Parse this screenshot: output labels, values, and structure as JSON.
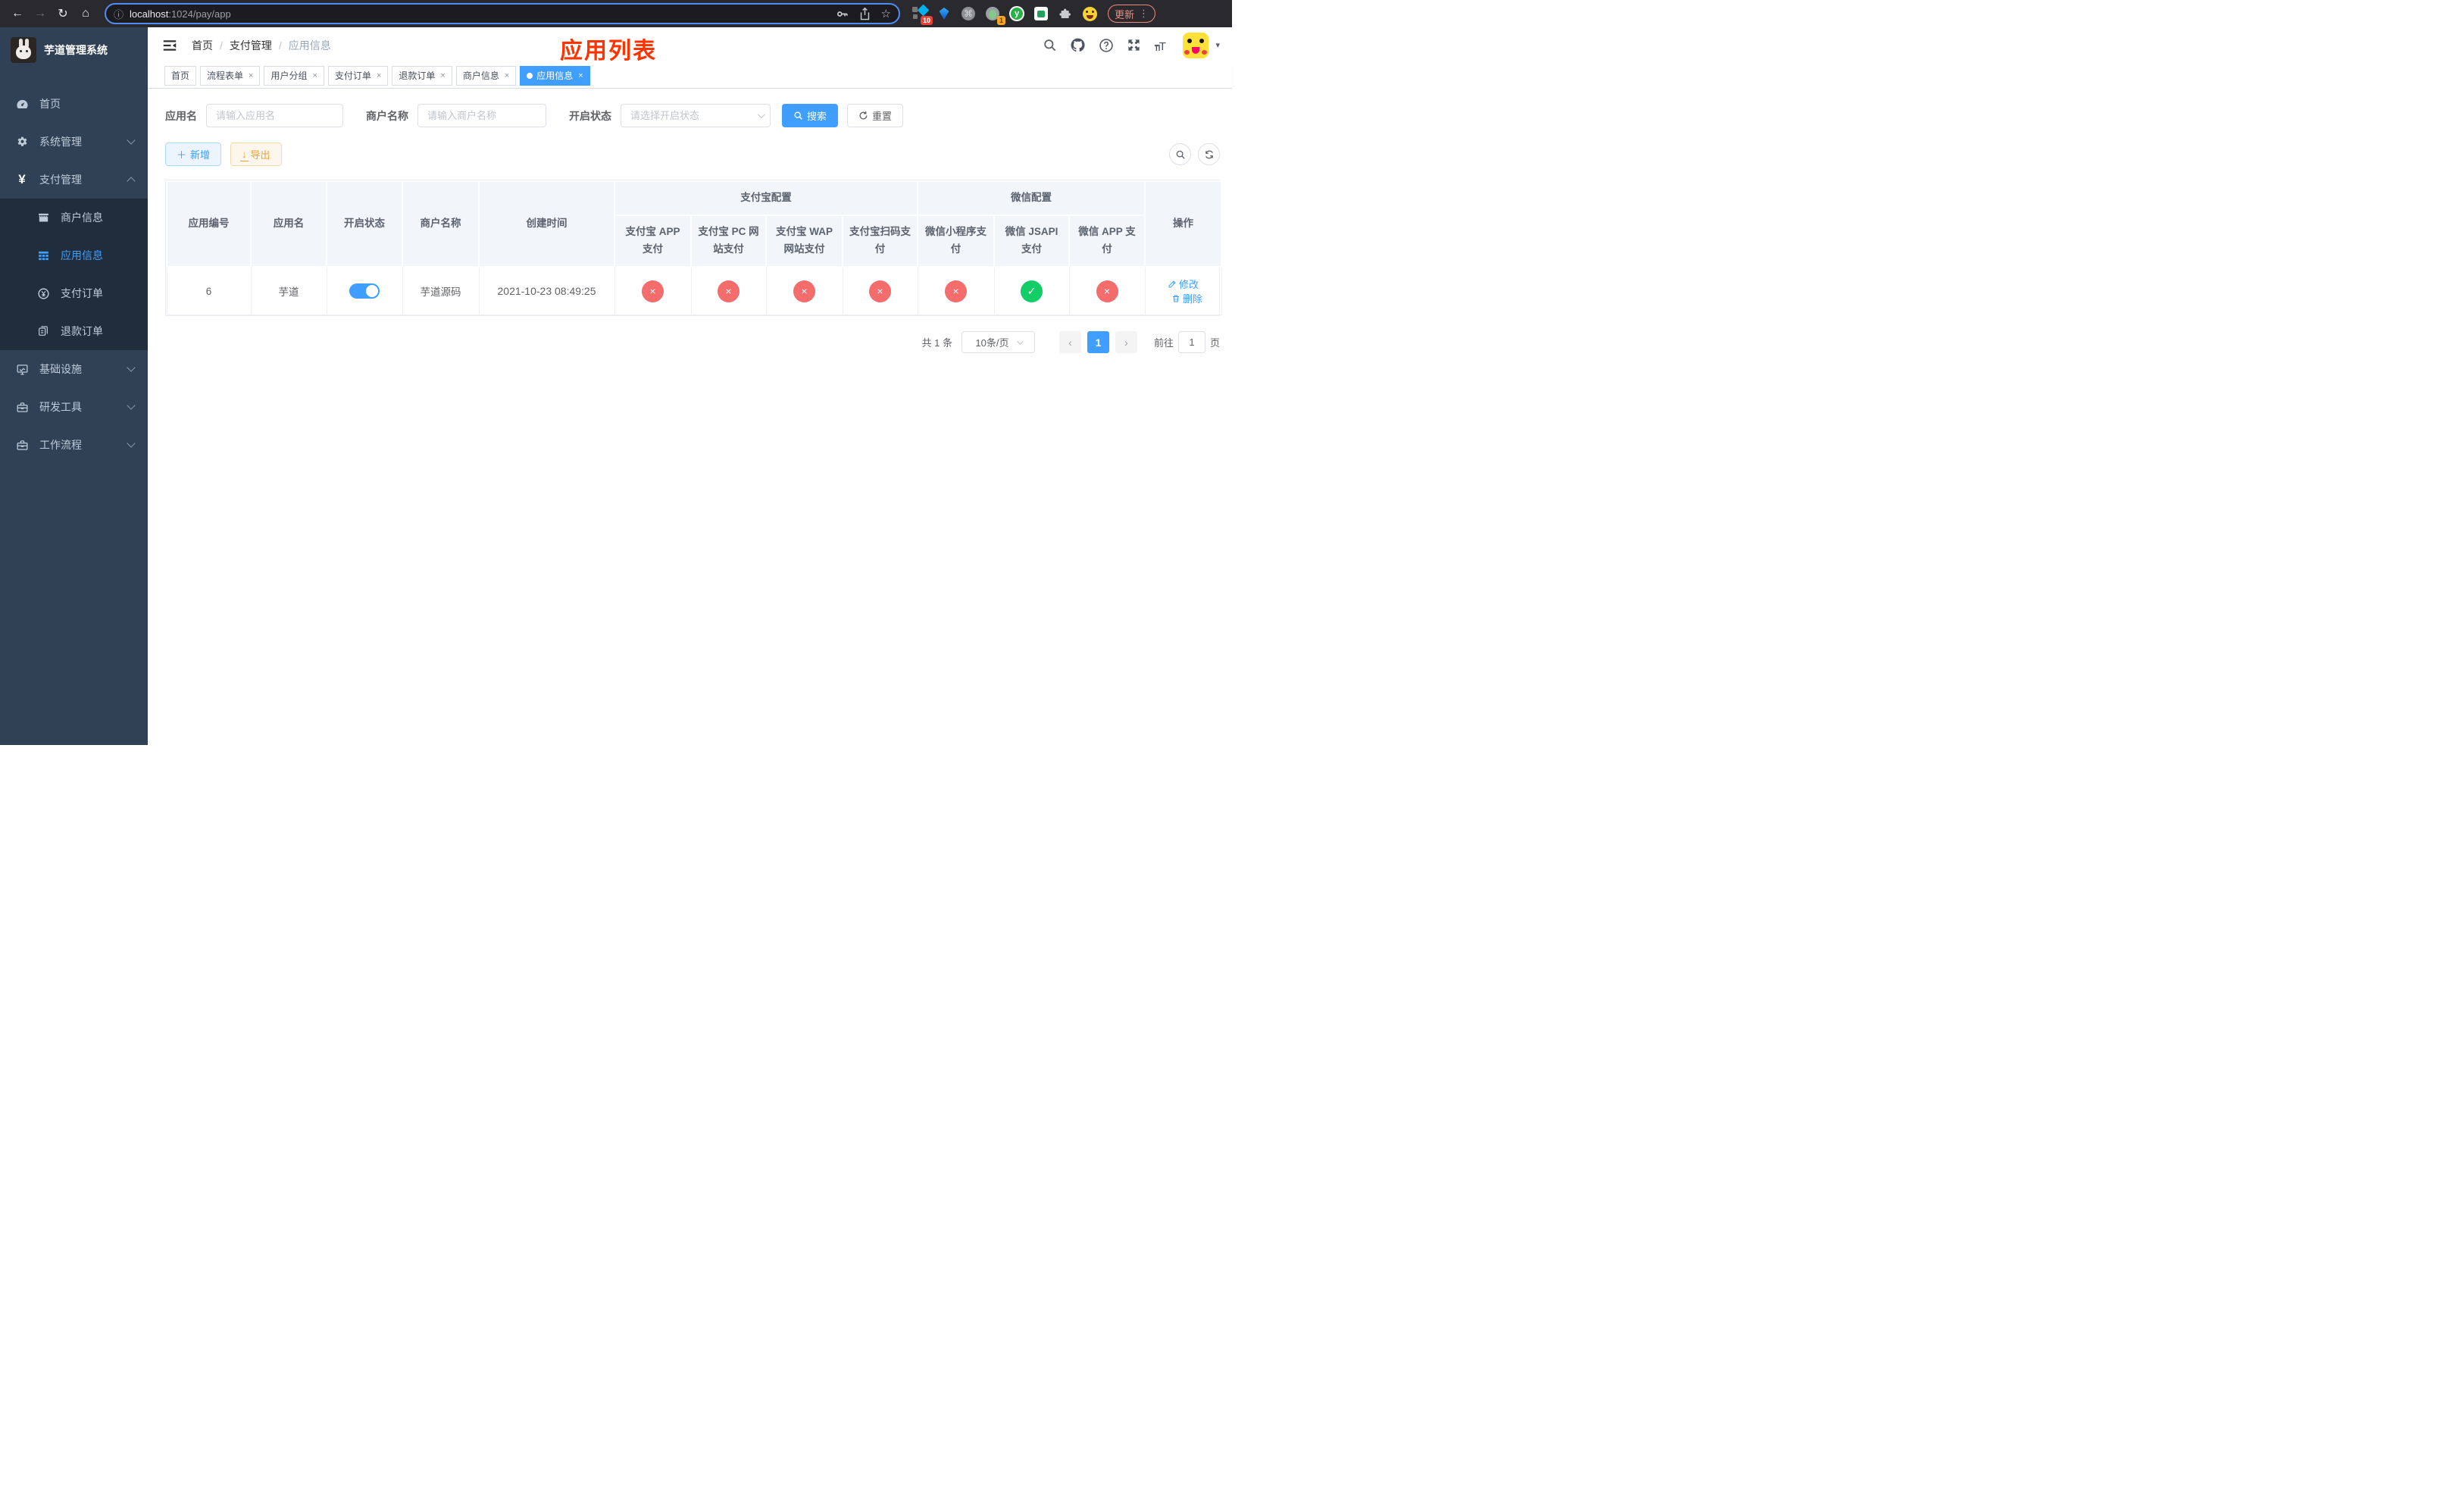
{
  "colors": {
    "accent": "#409eff",
    "danger": "#f56c6c",
    "success": "#13ce66",
    "title_red": "#ff3300",
    "warning": "#e6a23c",
    "sidebar_bg": "#304156",
    "submenu_bg": "#1f2d3d"
  },
  "icons": {
    "check": "✓",
    "cross": "×",
    "back": "←",
    "forward": "→",
    "reload": "↻",
    "home": "⌂",
    "info": "ⓘ",
    "star": "☆",
    "command": "⌘",
    "more": "⋮",
    "caret": "▾",
    "puzzle": "♟",
    "prev": "‹",
    "next": "›",
    "plus": "＋",
    "download": "↓",
    "dot_separator": "/"
  },
  "browser": {
    "url_host": "localhost",
    "url_rest": ":1024/pay/app",
    "ext_badge_ten": "10",
    "ext_badge_one": "1",
    "ext_y_label": "y",
    "update_label": "更新"
  },
  "sidebar": {
    "logo_title": "芋道管理系统",
    "home": "首页",
    "system": "系统管理",
    "payment": "支付管理",
    "payment_children": [
      "商户信息",
      "应用信息",
      "支付订单",
      "退款订单"
    ],
    "infra": "基础设施",
    "devtools": "研发工具",
    "workflow": "工作流程",
    "yuan": "¥"
  },
  "header": {
    "breadcrumb": [
      "首页",
      "支付管理",
      "应用信息"
    ],
    "separator": "/",
    "page_title": "应用列表"
  },
  "tabs": [
    {
      "label": "首页"
    },
    {
      "label": "流程表单"
    },
    {
      "label": "用户分组"
    },
    {
      "label": "支付订单"
    },
    {
      "label": "退款订单"
    },
    {
      "label": "商户信息"
    },
    {
      "label": "应用信息"
    }
  ],
  "filters": {
    "app_name_label": "应用名",
    "app_name_placeholder": "请输入应用名",
    "merchant_label": "商户名称",
    "merchant_placeholder": "请输入商户名称",
    "status_label": "开启状态",
    "status_placeholder": "请选择开启状态",
    "search_label": "搜索",
    "reset_label": "重置"
  },
  "toolbar": {
    "add_label": "新增",
    "export_label": "导出"
  },
  "table": {
    "columns": [
      "应用编号",
      "应用名",
      "开启状态",
      "商户名称",
      "创建时间"
    ],
    "groups": {
      "alipay": "支付宝配置",
      "wechat": "微信配置"
    },
    "sub_columns": [
      "支付宝 APP 支付",
      "支付宝 PC 网站支付",
      "支付宝 WAP 网站支付",
      "支付宝扫码支付",
      "微信小程序支付",
      "微信 JSAPI 支付",
      "微信 APP 支付"
    ],
    "actions_column": "操作",
    "rows": [
      {
        "id": "6",
        "name": "芋道",
        "enabled": true,
        "merchant": "芋道源码",
        "created_at": "2021-10-23 08:49:25",
        "statuses": [
          false,
          false,
          false,
          false,
          false,
          true,
          false
        ],
        "edit_label": "修改",
        "delete_label": "删除"
      }
    ]
  },
  "pagination": {
    "total": "共 1 条",
    "page_size": "10条/页",
    "prev": "‹",
    "next": "›",
    "current": "1",
    "goto_label": "前往",
    "goto_value": "1",
    "goto_unit": "页"
  }
}
